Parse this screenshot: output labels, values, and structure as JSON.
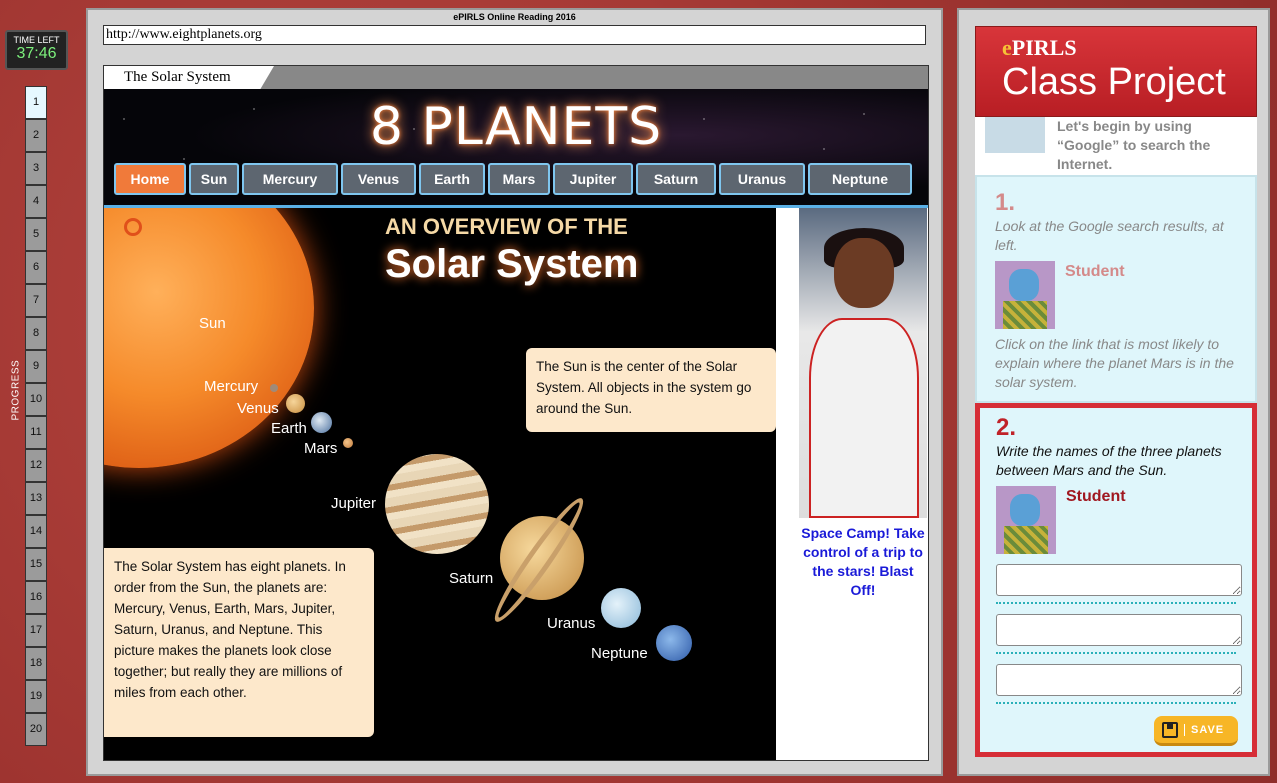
{
  "timer": {
    "label": "TIME LEFT",
    "value": "37:46"
  },
  "progress": {
    "label": "PROGRESS",
    "current": 1,
    "items": [
      "1",
      "2",
      "3",
      "4",
      "5",
      "6",
      "7",
      "8",
      "9",
      "10",
      "11",
      "12",
      "13",
      "14",
      "15",
      "16",
      "17",
      "18",
      "19",
      "20"
    ]
  },
  "main": {
    "header": "ePIRLS Online Reading 2016",
    "url": "http://www.eightplanets.org",
    "tab_title": "The Solar System"
  },
  "site": {
    "title": "8 PLANETS",
    "nav": [
      "Home",
      "Sun",
      "Mercury",
      "Venus",
      "Earth",
      "Mars",
      "Jupiter",
      "Saturn",
      "Uranus",
      "Neptune"
    ],
    "active_nav": "Home",
    "overview_pre": "AN OVERVIEW OF THE",
    "overview_main": "Solar System",
    "planet_labels": {
      "sun": "Sun",
      "mercury": "Mercury",
      "venus": "Venus",
      "earth": "Earth",
      "mars": "Mars",
      "jupiter": "Jupiter",
      "saturn": "Saturn",
      "uranus": "Uranus",
      "neptune": "Neptune"
    },
    "note_sun": "The Sun is the center of the Solar System. All objects in the system go around the Sun.",
    "note_planets": "The Solar System has eight planets. In order from the Sun, the planets are: Mercury, Venus, Earth, Mars, Jupiter, Saturn, Uranus, and Neptune. This picture makes the planets look close together; but really they are millions of miles from each other.",
    "ad_text": "Space Camp! Take control of a trip to the stars! Blast Off!"
  },
  "project": {
    "brand_e": "e",
    "brand_rest": "PIRLS",
    "title": "Class Project",
    "intro": "Let's begin by using “Google” to search the Internet.",
    "step1": {
      "number": "1.",
      "instruction": "Look at the Google search results, at left.",
      "student": "Student",
      "task": "Click on the link that is most likely to explain where the planet Mars is in the solar system."
    },
    "step2": {
      "number": "2.",
      "question": "Write the names of the three planets between Mars and the Sun.",
      "student": "Student",
      "answers": [
        "",
        "",
        ""
      ],
      "save_label": "SAVE"
    }
  },
  "colors": {
    "accent_red": "#d62d36",
    "nav_active": "#f07a3a",
    "nav_border": "#7fc6ef",
    "save": "#f7b626",
    "link": "#1a1ad8"
  }
}
